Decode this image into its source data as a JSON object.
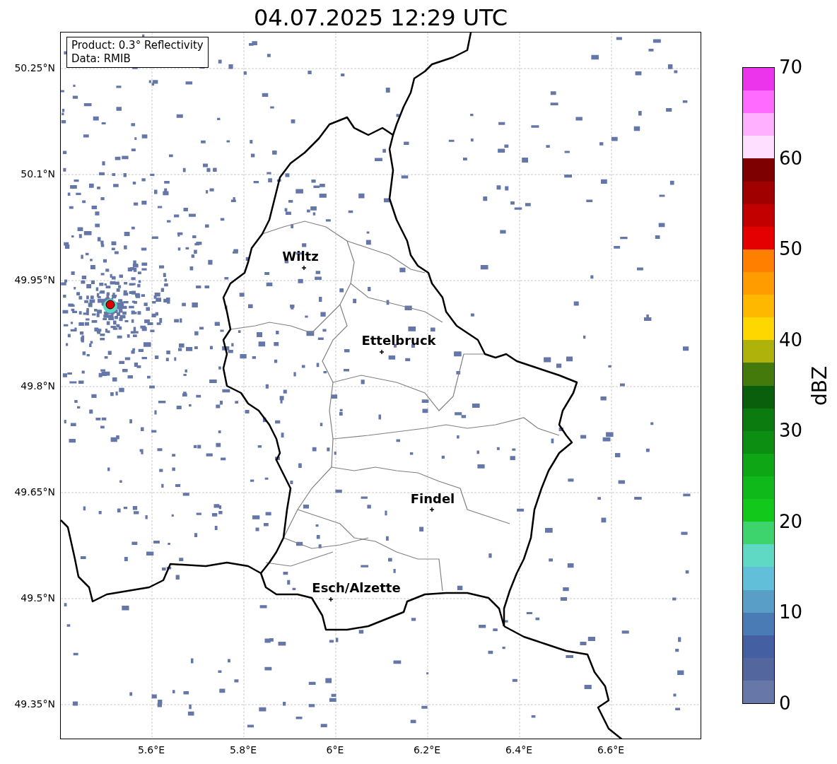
{
  "title": "04.07.2025 12:29 UTC",
  "info_box": {
    "lines": [
      "Product: 0.3° Reflectivity",
      "Data: RMIB"
    ]
  },
  "map": {
    "y_tick_labels": [
      "50.25°N",
      "50.1°N",
      "49.95°N",
      "49.8°N",
      "49.65°N",
      "49.5°N",
      "49.35°N"
    ],
    "x_tick_labels": [
      "5.6°E",
      "5.8°E",
      "6°E",
      "6.2°E",
      "6.4°E",
      "6.6°E"
    ],
    "cities": [
      {
        "name": "Wiltz"
      },
      {
        "name": "Ettelbruck"
      },
      {
        "name": "Findel"
      },
      {
        "name": "Esch/Alzette"
      }
    ]
  },
  "colorbar": {
    "label": "dBZ",
    "tick_labels": [
      "70",
      "60",
      "50",
      "40",
      "30",
      "20",
      "10",
      "0"
    ],
    "segments": [
      {
        "color": "#eb34eb"
      },
      {
        "color": "#ff6bff"
      },
      {
        "color": "#ffb0ff"
      },
      {
        "color": "#ffdfff"
      },
      {
        "color": "#7e0000"
      },
      {
        "color": "#a10000"
      },
      {
        "color": "#c30000"
      },
      {
        "color": "#e50000"
      },
      {
        "color": "#ff7f00"
      },
      {
        "color": "#ff9c00"
      },
      {
        "color": "#ffb800"
      },
      {
        "color": "#ffd700"
      },
      {
        "color": "#afb20a"
      },
      {
        "color": "#447a0b"
      },
      {
        "color": "#0a5f0d"
      },
      {
        "color": "#0b7b10"
      },
      {
        "color": "#0c8e12"
      },
      {
        "color": "#0ea615"
      },
      {
        "color": "#10b91a"
      },
      {
        "color": "#12c81a"
      },
      {
        "color": "#3ed46d"
      },
      {
        "color": "#5fd8c4"
      },
      {
        "color": "#62bfd9"
      },
      {
        "color": "#589ec6"
      },
      {
        "color": "#4a7bb5"
      },
      {
        "color": "#445fa2"
      },
      {
        "color": "#53669e"
      },
      {
        "color": "#6677a8"
      }
    ]
  }
}
